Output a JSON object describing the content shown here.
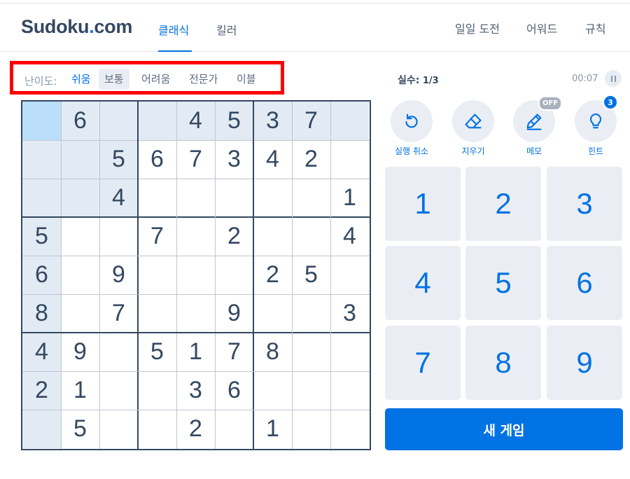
{
  "header": {
    "logo_text": "Sudoku",
    "logo_suffix": "com",
    "tabs": [
      {
        "label": "클래식",
        "active": true
      },
      {
        "label": "킬러",
        "active": false
      }
    ],
    "right_links": [
      "일일 도전",
      "어워드",
      "규칙"
    ]
  },
  "difficulty": {
    "label": "난이도:",
    "options": [
      {
        "label": "쉬움",
        "selected": true
      },
      {
        "label": "보통",
        "selected": false
      },
      {
        "label": "어려움",
        "selected": false
      },
      {
        "label": "전문가",
        "selected": false
      },
      {
        "label": "이블",
        "selected": false
      }
    ]
  },
  "status": {
    "mistakes_label": "실수:",
    "mistakes_value": "1/3",
    "timer": "00:07"
  },
  "board": {
    "selected_cell": [
      0,
      0
    ],
    "rows": [
      [
        "",
        "6",
        "",
        "",
        "4",
        "5",
        "3",
        "7",
        ""
      ],
      [
        "",
        "",
        "5",
        "6",
        "7",
        "3",
        "4",
        "2",
        ""
      ],
      [
        "",
        "",
        "4",
        "",
        "",
        "",
        "",
        "",
        "1"
      ],
      [
        "5",
        "",
        "",
        "7",
        "",
        "2",
        "",
        "",
        "4"
      ],
      [
        "6",
        "",
        "9",
        "",
        "",
        "",
        "2",
        "5",
        ""
      ],
      [
        "8",
        "",
        "7",
        "",
        "",
        "9",
        "",
        "",
        "3"
      ],
      [
        "4",
        "9",
        "",
        "5",
        "1",
        "7",
        "8",
        "",
        ""
      ],
      [
        "2",
        "1",
        "",
        "",
        "3",
        "6",
        "",
        "",
        ""
      ],
      [
        "",
        "5",
        "",
        "",
        "2",
        "",
        "1",
        "",
        ""
      ]
    ]
  },
  "tools": [
    {
      "label": "실행 취소",
      "icon": "undo-icon"
    },
    {
      "label": "지우기",
      "icon": "eraser-icon"
    },
    {
      "label": "메모",
      "icon": "pencil-icon",
      "badge": "OFF"
    },
    {
      "label": "힌트",
      "icon": "lightbulb-icon",
      "badge": "3"
    }
  ],
  "numpad": [
    "1",
    "2",
    "3",
    "4",
    "5",
    "6",
    "7",
    "8",
    "9"
  ],
  "new_game_label": "새 게임",
  "colors": {
    "accent": "#0072e3",
    "text": "#344861",
    "highlight": "#e2ebf3",
    "selected": "#bbdefb",
    "button_bg": "#eaeef4",
    "annotation_box": "#ff0000"
  }
}
